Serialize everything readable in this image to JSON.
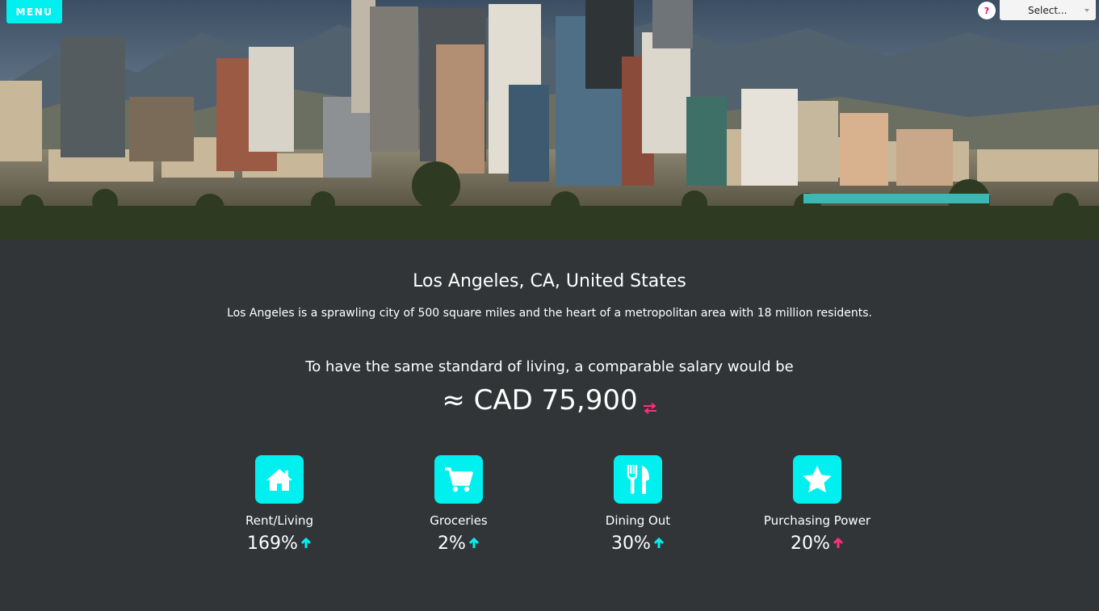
{
  "header": {
    "menu_label": "MENU",
    "help_label": "?",
    "select_placeholder": "Select..."
  },
  "city": {
    "name": "Los Angeles, CA, United States",
    "description": "Los Angeles is a sprawling city of 500 square miles and the heart of a metropolitan area with 18 million residents."
  },
  "salary": {
    "caption": "To have the same standard of living, a comparable salary would be",
    "value": "≈ CAD 75,900"
  },
  "stats": [
    {
      "icon": "house-icon",
      "label": "Rent/Living",
      "value": "169%",
      "trend": "up",
      "arrow_color": "#00f0f0"
    },
    {
      "icon": "cart-icon",
      "label": "Groceries",
      "value": "2%",
      "trend": "up",
      "arrow_color": "#00f0f0"
    },
    {
      "icon": "fork-knife-icon",
      "label": "Dining Out",
      "value": "30%",
      "trend": "up",
      "arrow_color": "#00f0f0"
    },
    {
      "icon": "star-icon",
      "label": "Purchasing Power",
      "value": "20%",
      "trend": "up",
      "arrow_color": "#ff2d7a"
    }
  ],
  "colors": {
    "accent": "#00f0f0",
    "highlight": "#ff2d7a",
    "background": "#323538"
  }
}
